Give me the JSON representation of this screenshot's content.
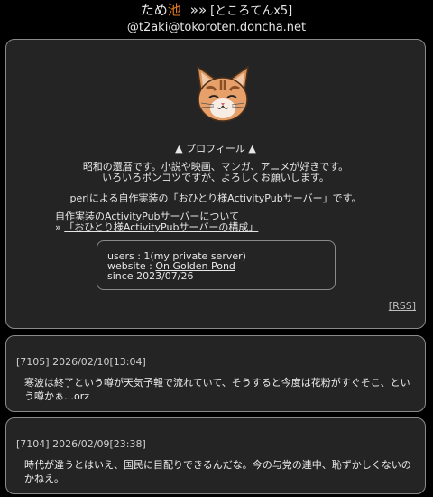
{
  "header": {
    "title_part1": "ため",
    "title_part2": "池",
    "title_arrows": "»»",
    "title_suffix": "[ところてんx5]",
    "handle": "@t2aki@tokoroten.doncha.net"
  },
  "profile": {
    "heading": "▲ プロフィール ▲",
    "bio_line1": "昭和の還暦です。小説や映画、マンガ、アニメが好きです。",
    "bio_line2": "いろいろポンコツですが、よろしくお願いします。",
    "perl_line": "perlによる自作実装の「おひとり様ActivityPubサーバー」です。",
    "impl_line1": "自作実装のActivityPubサーバーについて",
    "impl_prefix": "» ",
    "impl_link": "「おひとり様ActivityPubサーバーの構成」",
    "stats": {
      "users": "users : 1(my private server)",
      "website_label": "website : ",
      "website_link": "On Golden Pond",
      "since": "since 2023/07/26"
    },
    "rss": "[RSS]"
  },
  "posts": [
    {
      "meta": "[7105] 2026/02/10[13:04]",
      "body": "寒波は終了という噂が天気予報で流れていて、そうすると今度は花粉がすぐそこ、という噂かぁ…orz"
    },
    {
      "meta": "[7104] 2026/02/09[23:38]",
      "body": "時代が違うとはいえ、国民に目配りできるんだな。今の与党の連中、恥ずかしくないのかねえ。"
    }
  ],
  "colors": {
    "background": "#000000",
    "card": "#242424",
    "border": "#8a8a8a",
    "accent": "#e07a1f"
  }
}
